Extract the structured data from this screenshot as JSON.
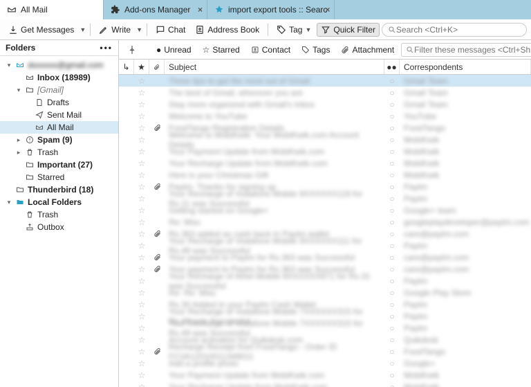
{
  "tabs": [
    {
      "label": "All Mail",
      "icon": "inbox",
      "close": false,
      "active": true
    },
    {
      "label": "Add-ons Manager",
      "icon": "puzzle",
      "close": true,
      "active": false
    },
    {
      "label": "import export tools :: Searc",
      "icon": "addon",
      "close": true,
      "active": false
    }
  ],
  "toolbar": {
    "get_messages": "Get Messages",
    "write": "Write",
    "chat": "Chat",
    "address_book": "Address Book",
    "tag": "Tag",
    "quick_filter": "Quick Filter",
    "search_placeholder": "Search <Ctrl+K>"
  },
  "sidebar": {
    "header": "Folders",
    "account_blurred": "dxxxxxx@gmail.com",
    "nodes": [
      {
        "id": "inbox",
        "label": "Inbox (18989)",
        "depth": 1,
        "icon": "inbox",
        "bold": true,
        "twisty": "",
        "sel": false
      },
      {
        "id": "gmail",
        "label": "[Gmail]",
        "depth": 1,
        "icon": "folder",
        "bold": false,
        "twisty": "▾",
        "sel": false,
        "italic": true
      },
      {
        "id": "drafts",
        "label": "Drafts",
        "depth": 2,
        "icon": "doc",
        "twisty": ""
      },
      {
        "id": "sentmail",
        "label": "Sent Mail",
        "depth": 2,
        "icon": "sent",
        "twisty": ""
      },
      {
        "id": "allmail",
        "label": "All Mail",
        "depth": 2,
        "icon": "inbox",
        "twisty": "",
        "sel": true
      },
      {
        "id": "spam",
        "label": "Spam (9)",
        "depth": 1,
        "icon": "spam",
        "bold": true,
        "twisty": "▸"
      },
      {
        "id": "trash",
        "label": "Trash",
        "depth": 1,
        "icon": "trash",
        "twisty": "▸"
      },
      {
        "id": "important",
        "label": "Important (27)",
        "depth": 1,
        "icon": "folder",
        "bold": true,
        "twisty": ""
      },
      {
        "id": "starred",
        "label": "Starred",
        "depth": 1,
        "icon": "folder",
        "twisty": ""
      },
      {
        "id": "thunderbird",
        "label": "Thunderbird (18)",
        "depth": 0,
        "icon": "folder",
        "bold": true,
        "twisty": ""
      },
      {
        "id": "localfolders",
        "label": "Local Folders",
        "depth": 0,
        "icon": "folderblue",
        "bold": true,
        "twisty": "▾"
      },
      {
        "id": "lf-trash",
        "label": "Trash",
        "depth": 1,
        "icon": "trash",
        "twisty": ""
      },
      {
        "id": "lf-outbox",
        "label": "Outbox",
        "depth": 1,
        "icon": "outbox",
        "twisty": ""
      }
    ]
  },
  "filterbar": {
    "unread": "Unread",
    "starred": "Starred",
    "contact": "Contact",
    "tags": "Tags",
    "attachment": "Attachment",
    "placeholder": "Filter these messages <Ctrl+Shift+K>"
  },
  "columns": {
    "subject": "Subject",
    "correspondents": "Correspondents"
  },
  "rows": [
    {
      "att": false,
      "sel": true,
      "subject": "Three tips to get the most out of Gmail",
      "corr": "Gmail Team"
    },
    {
      "att": false,
      "subject": "The best of Gmail, wherever you are",
      "corr": "Gmail Team"
    },
    {
      "att": false,
      "subject": "Stay more organized with Gmail's Inbox",
      "corr": "Gmail Team"
    },
    {
      "att": false,
      "subject": "Welcome to YouTube",
      "corr": "YouTube"
    },
    {
      "att": true,
      "subject": "FoodTango Registration Details",
      "corr": "FoodTango"
    },
    {
      "att": false,
      "subject": "Welcome to MobiKwik: Your MobiKwik.com Account Details",
      "corr": "MobiKwik"
    },
    {
      "att": false,
      "subject": "Your Payment Update from MobiKwik.com",
      "corr": "MobiKwik"
    },
    {
      "att": false,
      "subject": "Your Recharge Update from MobiKwik.com",
      "corr": "MobiKwik"
    },
    {
      "att": false,
      "subject": "Here is your Christmas Gift",
      "corr": "MobiKwik"
    },
    {
      "att": true,
      "subject": "Paytm: Thanks for signing up",
      "corr": "Paytm"
    },
    {
      "att": false,
      "subject": "Your Recharge of Vodafone Mobile 9XXXXXX118 for Rs.11 was Successful",
      "corr": "Paytm"
    },
    {
      "att": false,
      "subject": "Getting started on Google+",
      "corr": "Google+ team"
    },
    {
      "att": false,
      "subject": "Re: Misc",
      "corr": "googleplaydeveloper@paytm.com"
    },
    {
      "att": true,
      "subject": "Rs.363 added as cash back in Paytm wallet",
      "corr": "care@paytm.com"
    },
    {
      "att": false,
      "subject": "Your Recharge of Vodafone Mobile 9XXXXXX111 for Rs.49 was Successful",
      "corr": "Paytm"
    },
    {
      "att": true,
      "subject": "Your payment to Paytm for Rs.363 was Successful",
      "corr": "care@paytm.com"
    },
    {
      "att": true,
      "subject": "Your payment to Paytm for Rs.363 was Successful",
      "corr": "care@paytm.com"
    },
    {
      "att": false,
      "subject": "Your Recharge of Airtel Mobile 8XXXXXX871 for Rs.31 was Successful",
      "corr": "Paytm"
    },
    {
      "att": false,
      "subject": "Re: Re: Misc",
      "corr": "Google Play Store"
    },
    {
      "att": false,
      "subject": "Rs.30 Added in your Paytm Cash Wallet",
      "corr": "Paytm"
    },
    {
      "att": false,
      "subject": "Your Recharge of Vodafone Mobile 7XXXXXX315 for Rs.49 was Successful",
      "corr": "Paytm"
    },
    {
      "att": false,
      "subject": "Your Recharge of Vodafone Mobile 7XXXXXX315 for Rs.49 was Successful",
      "corr": "Paytm"
    },
    {
      "att": false,
      "subject": "Account activation for Quikdesk.com",
      "corr": "Quikdesk"
    },
    {
      "att": true,
      "subject": "Recharge Receipt from FoodTango - Order ID FCVA12010011349011",
      "corr": "FoodTango"
    },
    {
      "att": false,
      "subject": "Add a profile photo",
      "corr": "Google+"
    },
    {
      "att": false,
      "subject": "Your Payment Update from MobiKwik.com",
      "corr": "MobiKwik"
    },
    {
      "att": false,
      "subject": "Your Recharge Update from MobiKwik.com",
      "corr": "MobiKwik"
    }
  ],
  "icons": {
    "star": "☆",
    "paperclip": "📎",
    "dot": "•"
  }
}
